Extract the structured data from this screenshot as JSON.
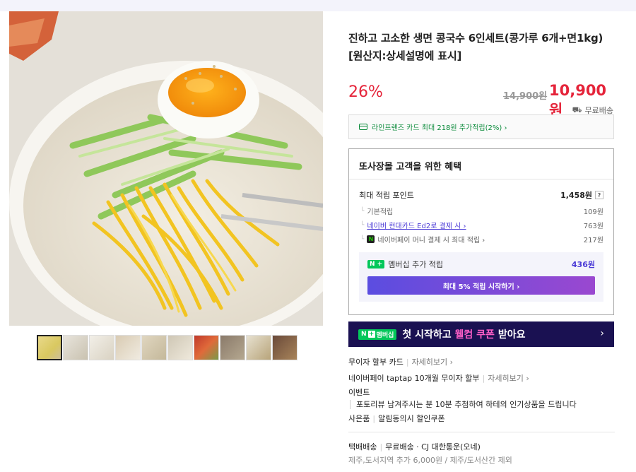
{
  "product": {
    "title": "진하고 고소한 생면 콩국수 6인세트(콩가루 6개+면1kg) [원산지:상세설명에 표시]",
    "discount": "26%",
    "original_price": "14,900원",
    "sale_price": "10,900원",
    "shipping": "무료배송"
  },
  "card_promo": {
    "text": "라인프렌즈 카드 최대 218원 추가적립(2%) ›"
  },
  "benefits": {
    "title": "또사장몰 고객을 위한 혜택",
    "max_points_label": "최대 적립 포인트",
    "max_points_value": "1,458원",
    "help": "?",
    "rows": [
      {
        "label": "기본적립",
        "value": "109원"
      },
      {
        "label": "네이버 현대카드 Ed2로 결제 시 ›",
        "value": "763원"
      },
      {
        "label": "네이버페이 머니 결제 시 최대 적립 ›",
        "value": "217원"
      }
    ],
    "membership_badge": "N +",
    "membership_label": "멤버십 추가 적립",
    "membership_value": "436원",
    "start_button": "최대 5% 적립 시작하기 ›"
  },
  "banner": {
    "badge": "멤버십",
    "text_pre": "첫 시작하고 ",
    "text_highlight": "웰컴 쿠폰",
    "text_post": " 받아요",
    "arrow": "›"
  },
  "info_lines": {
    "installment_card": "무이자 할부 카드",
    "installment_card_link": "자세히보기 ›",
    "taptap": "네이버페이 taptap 10개월 무이자 할부",
    "taptap_link": "자세히보기 ›",
    "event_label": "이벤트",
    "event_text": "포토리뷰 남겨주시는 분 10분 추첨하여 하테의 인기상품을 드립니다",
    "gift_label": "사은품",
    "gift_text": "알림동의시 할인쿠폰",
    "delivery_label": "택배배송",
    "delivery_text": "무료배송 · CJ 대한통운(오네)",
    "extra_fee": "제주,도서지역 추가 6,000원 / 제주/도서산간 제외"
  },
  "colors": {
    "accent_red": "#e5243a",
    "naver_green": "#03c75a",
    "link_purple": "#4a3ad6",
    "banner_bg": "#1a1152"
  }
}
